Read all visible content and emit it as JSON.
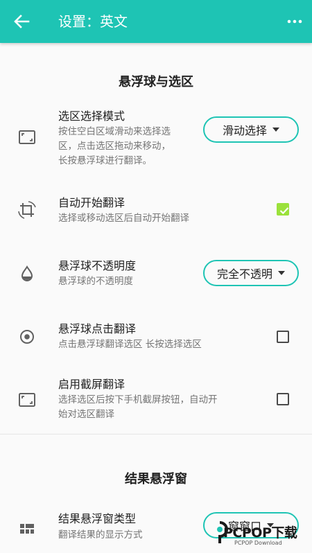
{
  "header": {
    "back_icon": "arrow-left-icon",
    "title": "设置：英文",
    "more_icon": "more-vert-icon",
    "color": "#1ec4b4"
  },
  "sections": [
    {
      "title": "悬浮球与选区",
      "rows": [
        {
          "icon": "selection-frame-icon",
          "title": "选区选择模式",
          "desc_lines": [
            "按住空白区域滑动来选择选",
            "区，点击选区拖动来移动，",
            "长按悬浮球进行翻译。"
          ],
          "control": "dropdown",
          "value": "滑动选择"
        },
        {
          "icon": "crop-rotate-icon",
          "title": "自动开始翻译",
          "desc": "选择或移动选区后自动开始翻译",
          "control": "checkbox",
          "checked": true
        },
        {
          "icon": "opacity-drop-icon",
          "title": "悬浮球不透明度",
          "desc": "悬浮球的不透明度",
          "control": "dropdown",
          "value": "完全不透明"
        },
        {
          "icon": "radio-target-icon",
          "title": "悬浮球点击翻译",
          "desc": "点击悬浮球翻译选区 长按选择选区",
          "control": "checkbox",
          "checked": false
        },
        {
          "icon": "selection-frame-icon",
          "title": "启用截屏翻译",
          "desc_lines": [
            "选择选区后按下手机截屏按钮，自动开",
            "始对选区翻译"
          ],
          "control": "checkbox",
          "checked": false
        }
      ]
    },
    {
      "title": "结果悬浮窗",
      "rows": [
        {
          "icon": "dashboard-grid-icon",
          "title": "结果悬浮窗类型",
          "desc": "翻译结果的显示方式",
          "control": "dropdown",
          "value": "窗窗口"
        }
      ]
    }
  ],
  "watermark": {
    "big": "PCPOP下载",
    "small": "PCPOP Download"
  }
}
